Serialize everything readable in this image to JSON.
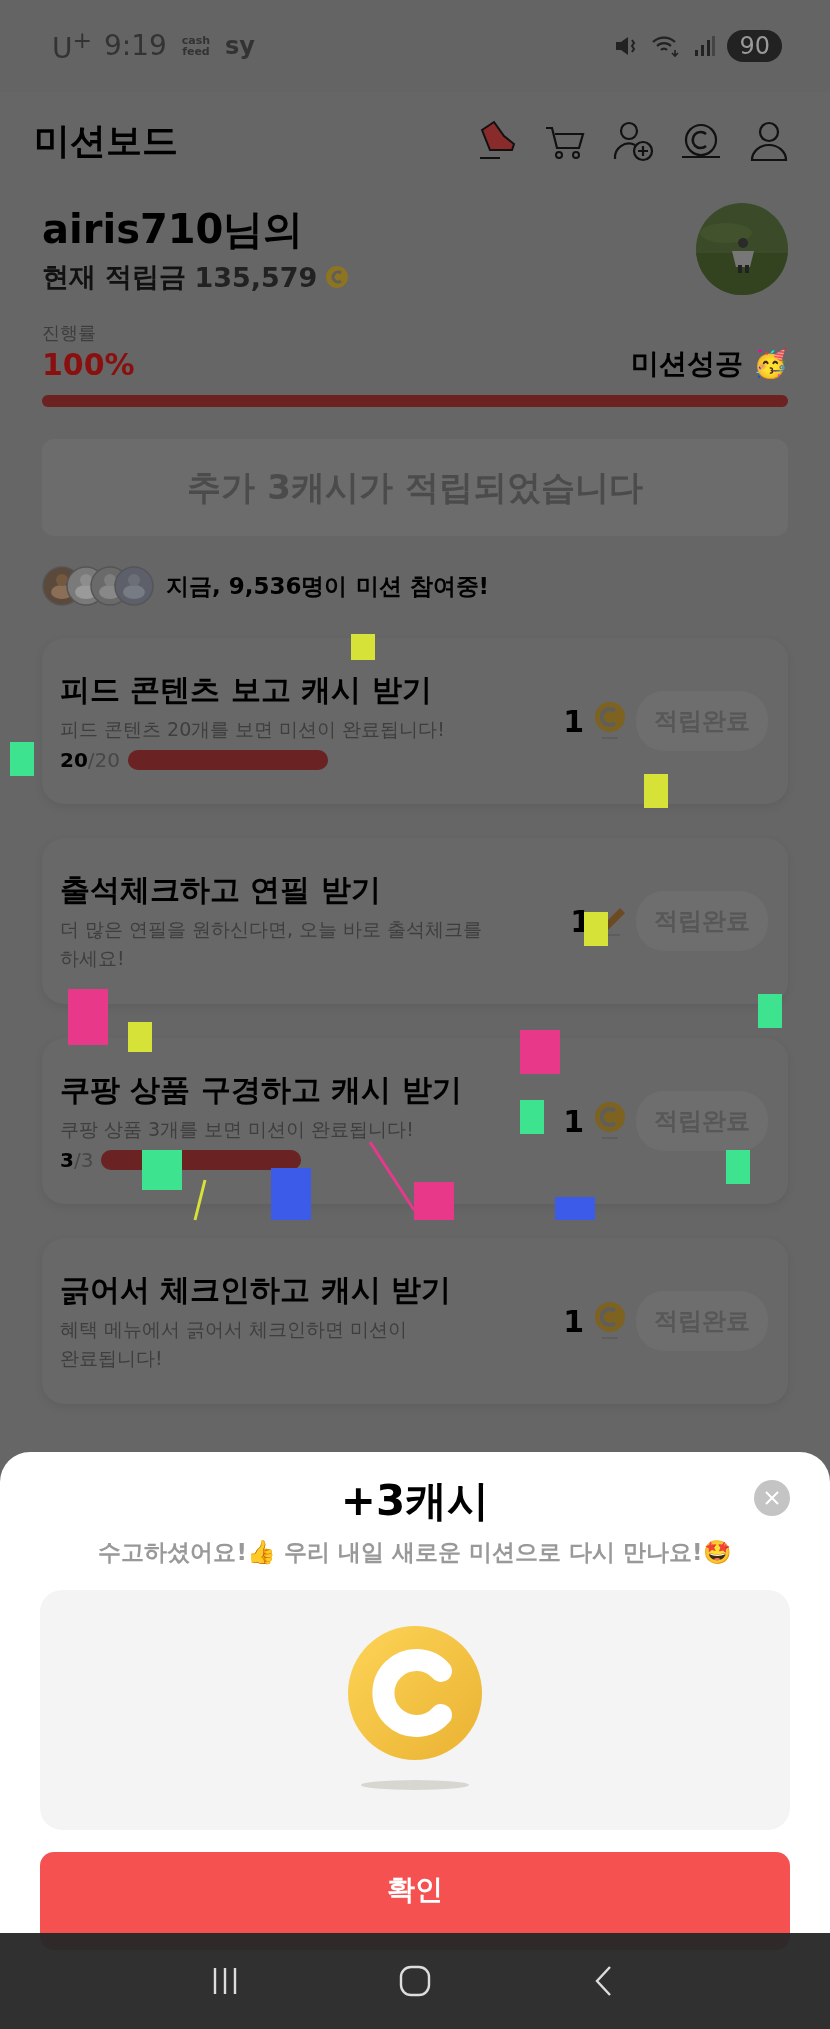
{
  "status_bar": {
    "carrier": "U$^{+}$",
    "time": "9:19",
    "app_badges": [
      "cash feed",
      "sy"
    ],
    "battery": "90"
  },
  "header": {
    "title": "미션보드"
  },
  "profile": {
    "name": "airis710님의",
    "balance_label": "현재 적립금",
    "balance": "135,579"
  },
  "progress": {
    "label": "진행률",
    "percent": "100%",
    "status": "미션성공 🥳",
    "level": 1
  },
  "banner": {
    "text": "추가 3캐시가 적립되었습니다"
  },
  "participants": {
    "text": "지금, 9,536명이 미션 참여중!"
  },
  "missions": [
    {
      "title": "피드 콘텐츠 보고 캐시 받기",
      "description": "피드 콘텐츠 20개를 보면 미션이 완료됩니다!",
      "count": "**20**/20",
      "level": 1,
      "reward": "1",
      "kind": "coin",
      "button": "적립완료"
    },
    {
      "title": "출석체크하고 연필 받기",
      "description": "더 많은 연필을 원하신다면, 오늘 바로 출석체크를 하세요!",
      "reward": "1",
      "kind": "pencil",
      "button": "적립완료"
    },
    {
      "title": "쿠팡 상품 구경하고 캐시 받기",
      "description": "쿠팡 상품 3개를 보면 미션이 완료됩니다!",
      "count": "**3**/3",
      "level": 1,
      "reward": "1",
      "kind": "coin",
      "button": "적립완료"
    },
    {
      "title": "긁어서 체크인하고 캐시 받기",
      "description": "혜택 메뉴에서 긁어서 체크인하면 미션이 완료됩니다!",
      "reward": "1",
      "kind": "coin",
      "button": "적립완료"
    }
  ],
  "sheet": {
    "title": "+3캐시",
    "message": "수고하셨어요!👍 우리 내일 새로운 미션으로 다시 만나요!🤩",
    "confirm": "확인"
  }
}
